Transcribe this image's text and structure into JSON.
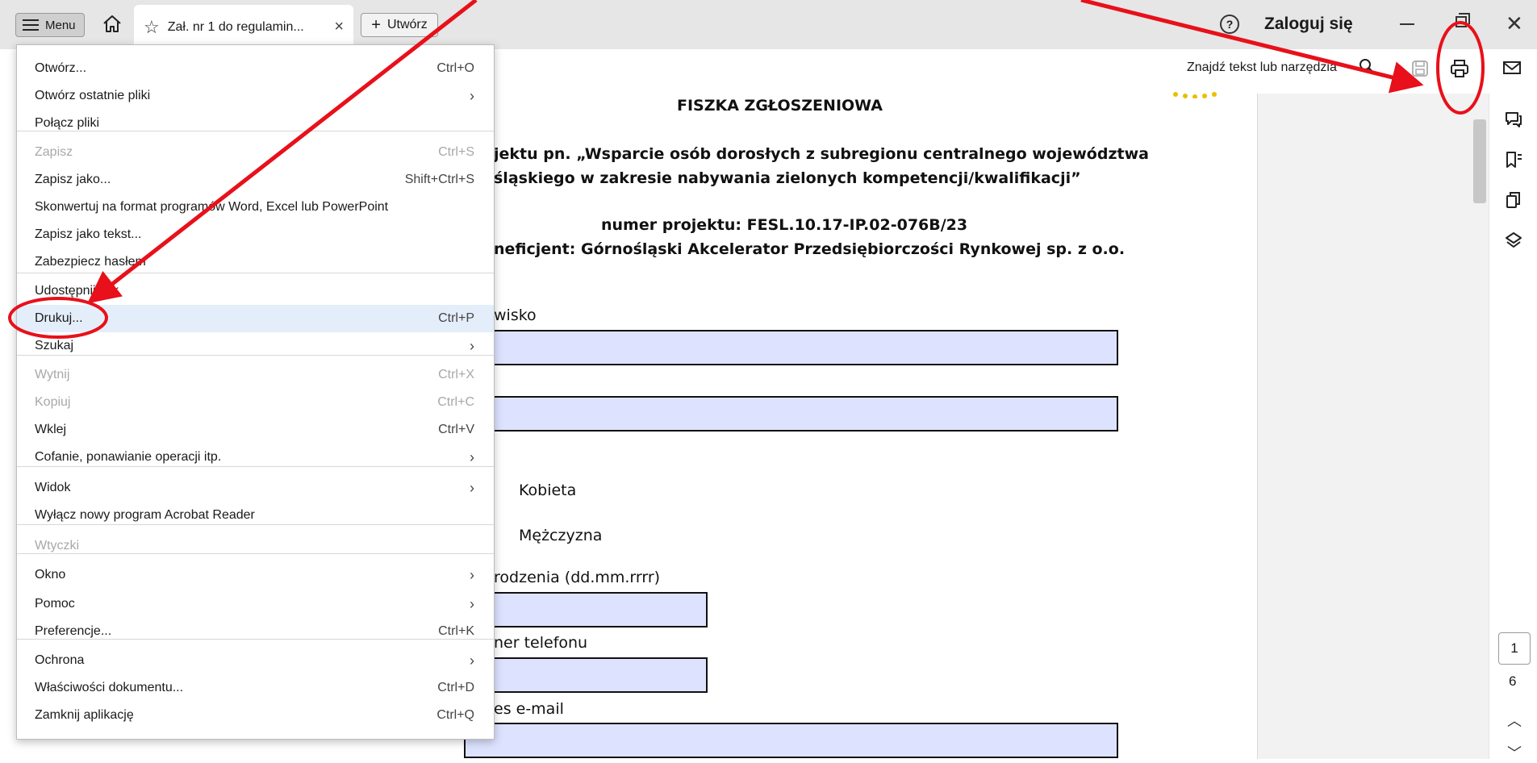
{
  "titlebar": {
    "menu_label": "Menu",
    "tab_title": "Zał. nr 1 do regulamin...",
    "new_label": "Utwórz",
    "help_symbol": "?",
    "login_label": "Zaloguj się"
  },
  "toolbar": {
    "find_label": "Znajdź tekst lub narzędzia"
  },
  "menu": {
    "items": [
      {
        "label": "Otwórz...",
        "shortcut": "Ctrl+O",
        "arrow": "",
        "disabled": false
      },
      {
        "label": "Otwórz ostatnie pliki",
        "shortcut": "",
        "arrow": "›",
        "disabled": false
      },
      {
        "label": "Połącz pliki",
        "shortcut": "",
        "arrow": "",
        "disabled": false
      },
      {
        "label": "Zapisz",
        "shortcut": "Ctrl+S",
        "arrow": "",
        "disabled": true
      },
      {
        "label": "Zapisz jako...",
        "shortcut": "Shift+Ctrl+S",
        "arrow": "",
        "disabled": false
      },
      {
        "label": "Skonwertuj na format programów Word, Excel lub PowerPoint",
        "shortcut": "",
        "arrow": "",
        "disabled": false
      },
      {
        "label": "Zapisz jako tekst...",
        "shortcut": "",
        "arrow": "",
        "disabled": false
      },
      {
        "label": "Zabezpiecz hasłem",
        "shortcut": "",
        "arrow": "",
        "disabled": false
      },
      {
        "label": "Udostępnij plik",
        "shortcut": "",
        "arrow": "",
        "disabled": false
      },
      {
        "label": "Drukuj...",
        "shortcut": "Ctrl+P",
        "arrow": "",
        "disabled": false
      },
      {
        "label": "Szukaj",
        "shortcut": "",
        "arrow": "›",
        "disabled": false
      },
      {
        "label": "Wytnij",
        "shortcut": "Ctrl+X",
        "arrow": "",
        "disabled": true
      },
      {
        "label": "Kopiuj",
        "shortcut": "Ctrl+C",
        "arrow": "",
        "disabled": true
      },
      {
        "label": "Wklej",
        "shortcut": "Ctrl+V",
        "arrow": "",
        "disabled": false
      },
      {
        "label": "Cofanie, ponawianie operacji itp.",
        "shortcut": "",
        "arrow": "›",
        "disabled": false
      },
      {
        "label": "Widok",
        "shortcut": "",
        "arrow": "›",
        "disabled": false
      },
      {
        "label": "Wyłącz nowy program Acrobat Reader",
        "shortcut": "",
        "arrow": "",
        "disabled": false
      },
      {
        "label": "Wtyczki",
        "shortcut": "",
        "arrow": "",
        "disabled": true
      },
      {
        "label": "Okno",
        "shortcut": "",
        "arrow": "›",
        "disabled": false
      },
      {
        "label": "Pomoc",
        "shortcut": "",
        "arrow": "›",
        "disabled": false
      },
      {
        "label": "Preferencje...",
        "shortcut": "Ctrl+K",
        "arrow": "",
        "disabled": false
      },
      {
        "label": "Ochrona",
        "shortcut": "",
        "arrow": "›",
        "disabled": false
      },
      {
        "label": "Właściwości dokumentu...",
        "shortcut": "Ctrl+D",
        "arrow": "",
        "disabled": false
      },
      {
        "label": "Zamknij aplikację",
        "shortcut": "Ctrl+Q",
        "arrow": "",
        "disabled": false
      }
    ]
  },
  "document": {
    "heading": "FISZKA ZGŁOSZENIOWA",
    "line1": "jektu pn. „Wsparcie osób dorosłych z subregionu centralnego województwa",
    "line2": "śląskiego w zakresie nabywania zielonych kompetencji/kwalifikacji”",
    "line3": "numer projektu: FESL.10.17-IP.02-076B/23",
    "line4": "neficjent: Górnośląski Akcelerator Przedsiębiorczości Rynkowej sp. z o.o.",
    "label_surname": "wisko",
    "option_female": "Kobieta",
    "option_male": "Mężczyzna",
    "label_birthdate": "urodzenia (dd.mm.rrrr)",
    "label_phone": "ner telefonu",
    "label_email": "es e-mail"
  },
  "pager": {
    "current": "1",
    "total": "6"
  },
  "colors": {
    "annotation_red": "#e8101a",
    "field_fill": "#dde3ff",
    "highlight": "#e4eefa"
  }
}
